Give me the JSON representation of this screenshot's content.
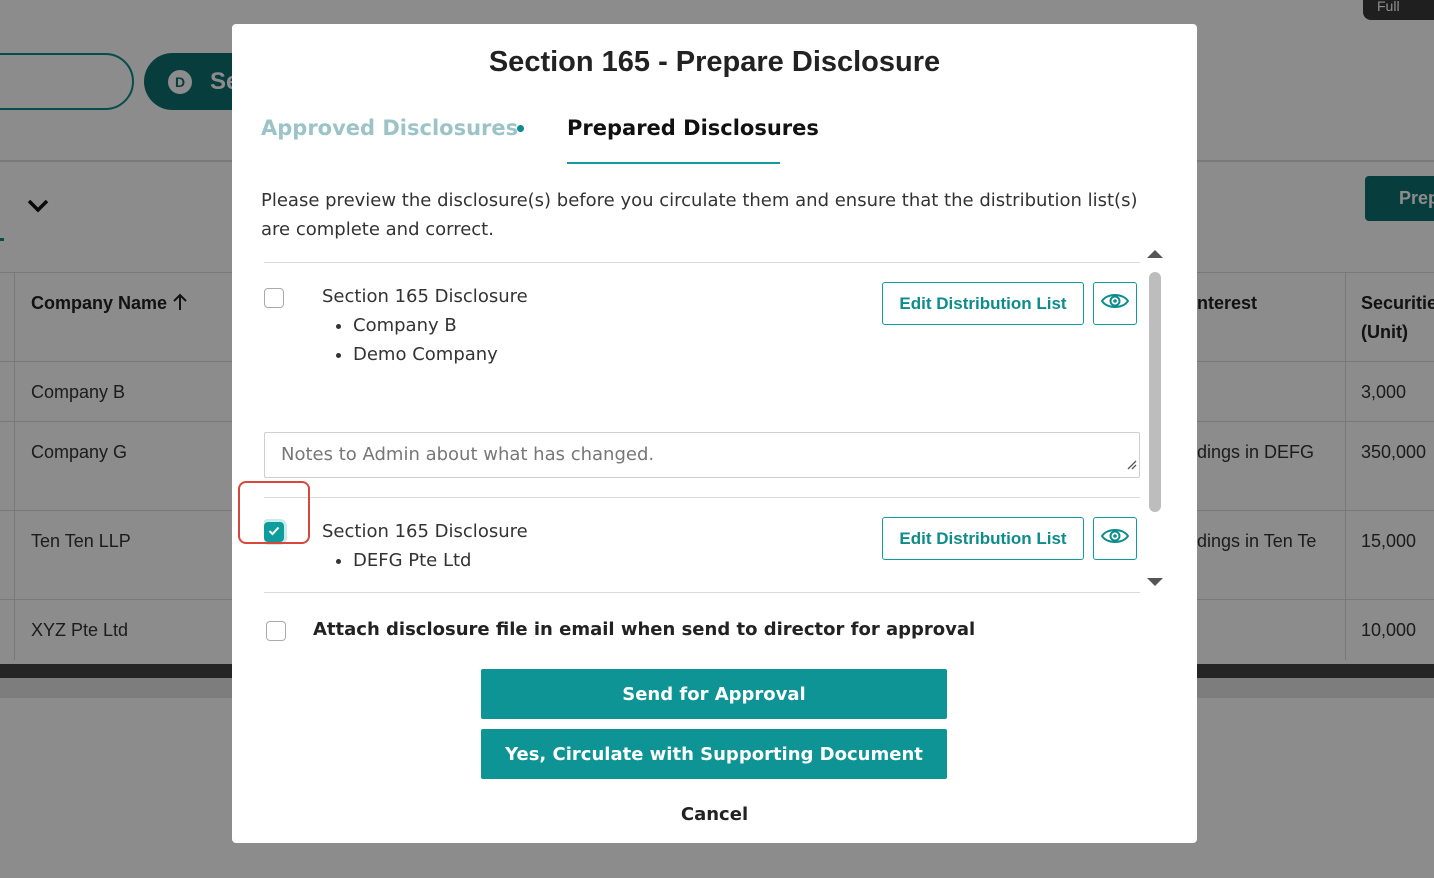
{
  "background": {
    "pill_solid_label": "Se",
    "pill_solid_icon_letter": "D",
    "full_button_label": "Full",
    "prepare_button_label": "Prep",
    "table": {
      "headers": [
        "Company Name",
        "nterest",
        "Securitie",
        "(Unit)"
      ],
      "rows": [
        {
          "company": "Company B",
          "interest": "",
          "securities": "3,000"
        },
        {
          "company": "Company G",
          "interest": "dings in DEFG",
          "securities": "350,000"
        },
        {
          "company": "Ten Ten LLP",
          "interest": "dings in Ten Te",
          "securities": "15,000"
        },
        {
          "company": "XYZ Pte Ltd",
          "interest": "",
          "securities": "10,000"
        }
      ]
    }
  },
  "modal": {
    "title": "Section 165 - Prepare Disclosure",
    "tabs": {
      "approved": "Approved Disclosures",
      "prepared": "Prepared Disclosures"
    },
    "intro": "Please preview the disclosure(s) before you circulate them and ensure that the distribution list(s) are complete and correct.",
    "disclosures": [
      {
        "title": "Section 165 Disclosure",
        "companies": [
          "Company B",
          "Demo Company"
        ],
        "checked": false,
        "edit_label": "Edit Distribution List"
      },
      {
        "title": "Section 165 Disclosure",
        "companies": [
          "DEFG Pte Ltd"
        ],
        "checked": true,
        "edit_label": "Edit Distribution List"
      }
    ],
    "notes_placeholder": "Notes to Admin about what has changed.",
    "attach_label": "Attach disclosure file in email when send to director for approval",
    "send_button": "Send for Approval",
    "circulate_button": "Yes, Circulate with Supporting Document",
    "cancel_button": "Cancel"
  },
  "colors": {
    "accent": "#0e9494",
    "highlight": "#d9473c"
  }
}
